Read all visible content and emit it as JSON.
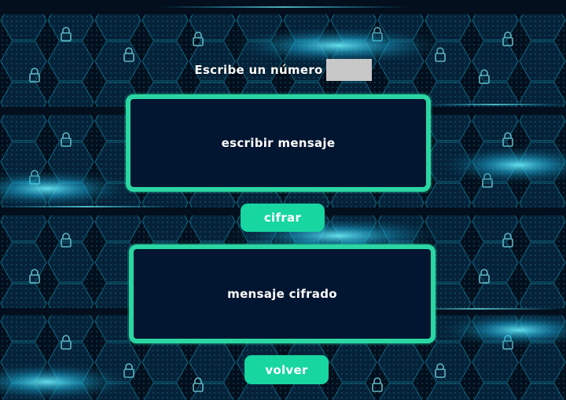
{
  "number_prompt": {
    "label": "Escribe un número",
    "value": ""
  },
  "message_input": {
    "placeholder": "escribir mensaje"
  },
  "encrypt_button": {
    "label": "cifrar"
  },
  "encrypted_output": {
    "placeholder": "mensaje cifrado"
  },
  "back_button": {
    "label": "volver"
  },
  "colors": {
    "accent": "#2ad6a2",
    "button": "#17d6a0",
    "panel": "#031631",
    "background": "#03101f",
    "glow": "#2fd7ff",
    "input": "#c8c8c8"
  },
  "background_icons": [
    "padlock-icon",
    "hexagon-pattern"
  ]
}
